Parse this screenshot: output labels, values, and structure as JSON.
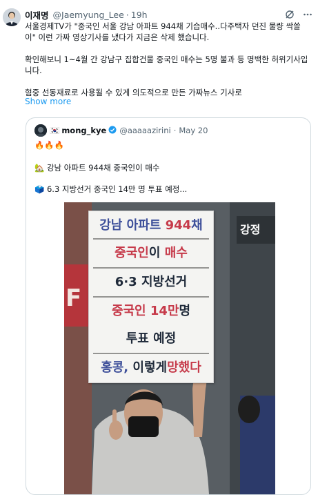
{
  "tweet": {
    "author_name": "이재명",
    "author_handle": "@Jaemyung_Lee",
    "time": "19h",
    "separator": "·",
    "text_lines": [
      "서울경제TV가 \"중국인 서울 강남 아파트 944채 기습매수..다주택자 던진 물량 싹쓸",
      "이\" 이런 가짜 영상기사를 냈다가 지금은 삭제 했습니다."
    ],
    "text2_lines": [
      "확인해보니 1~4월 간 강남구 집합건물 중국인 매수는 5명 불과 등 명백한 허위기사입",
      "니다."
    ],
    "text3": "혐중 선동재료로 사용될 수 있게 의도적으로 만든 가짜뉴스 기사로",
    "show_more": "Show more",
    "icons": [
      "grok-icon",
      "more-icon"
    ]
  },
  "quote": {
    "flag": "🇰🇷",
    "name": "mong_kye",
    "handle": "@aaaaazirini",
    "time": "May 20",
    "separator": "·",
    "line1": "🔥🔥🔥",
    "line2": "🏡 강남 아파트 944채 중국인이 매수",
    "line3": "🗳️ 6.3 지방선거 중국인 14만 명 투표 예정..."
  },
  "sign": {
    "line1": [
      {
        "t": "강남 아파트 ",
        "c": "blue"
      },
      {
        "t": "944",
        "c": "red"
      },
      {
        "t": "채",
        "c": "blue"
      }
    ],
    "line2": [
      {
        "t": "중국인",
        "c": "red"
      },
      {
        "t": "이 ",
        "c": "dark"
      },
      {
        "t": "매수",
        "c": "red"
      }
    ],
    "line3": [
      {
        "t": "6·3 지방선거",
        "c": "dark"
      }
    ],
    "line4": [
      {
        "t": "중국인 ",
        "c": "red"
      },
      {
        "t": "14만",
        "c": "red"
      },
      {
        "t": "명",
        "c": "dark"
      }
    ],
    "line5": [
      {
        "t": "투표 예정",
        "c": "dark"
      }
    ],
    "line6": [
      {
        "t": "홍콩, ",
        "c": "blue"
      },
      {
        "t": "이렇게",
        "c": "dark"
      },
      {
        "t": "망했다",
        "c": "red"
      }
    ]
  },
  "photo_text": {
    "store_sign": "강정",
    "background_letter": "F"
  },
  "colors": {
    "link": "#1d9bf0",
    "muted": "#536471",
    "border": "#cfd9de",
    "verified": "#1d9bf0"
  }
}
